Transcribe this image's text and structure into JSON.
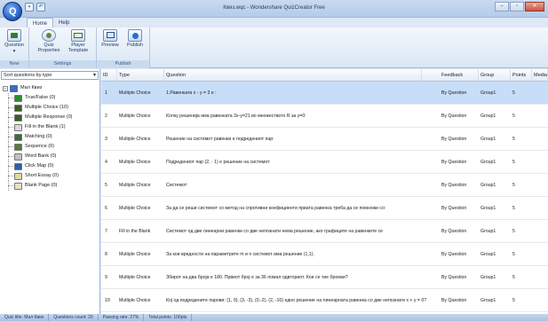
{
  "window": {
    "title": "Квиз.wqc - Wondershare QuizCreator Free",
    "controls": [
      "minimize",
      "maximize",
      "close"
    ]
  },
  "tabs": [
    {
      "label": "Home",
      "active": true
    },
    {
      "label": "Help",
      "active": false
    }
  ],
  "ribbon": {
    "groups": [
      {
        "label": "New",
        "buttons": [
          {
            "label": "Question",
            "icon": "question-icon"
          }
        ]
      },
      {
        "label": "Settings",
        "buttons": [
          {
            "label": "Quiz Properties",
            "icon": "gear-icon"
          },
          {
            "label": "Player Template",
            "icon": "template-icon"
          }
        ]
      },
      {
        "label": "Publish",
        "buttons": [
          {
            "label": "Preview",
            "icon": "preview-icon"
          },
          {
            "label": "Publish",
            "icon": "publish-icon"
          }
        ]
      }
    ]
  },
  "sidebar": {
    "sort_label": "Sort questions by type",
    "root": "Мал Квиз",
    "items": [
      {
        "label": "True/False  (0)",
        "color": "#2f8a2f"
      },
      {
        "label": "Multiple Choice  (10)",
        "color": "#3a5c2a"
      },
      {
        "label": "Multiple Response  (0)",
        "color": "#3a5c2a"
      },
      {
        "label": "Fill in the Blank  (1)",
        "color": "#d9d9d9"
      },
      {
        "label": "Matching  (0)",
        "color": "#3b6b3b"
      },
      {
        "label": "Sequence  (0)",
        "color": "#5a7a3a"
      },
      {
        "label": "Word Bank  (0)",
        "color": "#c0c0c0"
      },
      {
        "label": "Click Map  (0)",
        "color": "#2e5fa8"
      },
      {
        "label": "Short Essay  (0)",
        "color": "#e0d8a8"
      },
      {
        "label": "Blank Page  (0)",
        "color": "#e8e0c8"
      }
    ]
  },
  "grid": {
    "columns": [
      "ID",
      "Type",
      "Question",
      "Feedback",
      "Group",
      "Points",
      "Media"
    ],
    "rows": [
      {
        "id": "1",
        "type": "Multiple Choice",
        "question": "1.Равенката  x - y = 3  е :",
        "feedback": "By Question",
        "group": "Group1",
        "points": "5"
      },
      {
        "id": "2",
        "type": "Multiple Choice",
        "question": "Колку решенија има равенката 3x-y=21 во множеството R за y=0:",
        "feedback": "By Question",
        "group": "Group1",
        "points": "5"
      },
      {
        "id": "3",
        "type": "Multiple Choice",
        "question": "Решение на системот равенки  е подредениот пар:",
        "feedback": "By Question",
        "group": "Group1",
        "points": "5"
      },
      {
        "id": "4",
        "type": "Multiple Choice",
        "question": "Подредениот пар (2, - 1) е решение на системот",
        "feedback": "By Question",
        "group": "Group1",
        "points": "5"
      },
      {
        "id": "5",
        "type": "Multiple Choice",
        "question": "Системот:",
        "feedback": "By Question",
        "group": "Group1",
        "points": "5"
      },
      {
        "id": "6",
        "type": "Multiple Choice",
        "question": "За да се реши системот  со метод  на спротивни коефициенти  првата равенка треба да се помножи со:",
        "feedback": "By Question",
        "group": "Group1",
        "points": "5"
      },
      {
        "id": "7",
        "type": "Fill in the Blank",
        "question": "Системот од две линеарни равенки со две непознати нема решение, ако графиците на равенките се",
        "feedback": "By Question",
        "group": "Group1",
        "points": "5"
      },
      {
        "id": "8",
        "type": "Multiple Choice",
        "question": "За кои вредности на параметрите m и n системот   има решение (1,1).",
        "feedback": "By Question",
        "group": "Group1",
        "points": "5"
      },
      {
        "id": "9",
        "type": "Multiple Choice",
        "question": "Збирот на два броја е 180. Првиот број е за 36 помал одвториот. Кои се тие броеви?",
        "feedback": "By Question",
        "group": "Group1",
        "points": "5"
      },
      {
        "id": "10",
        "type": "Multiple Choice",
        "question": "Кој од подредените парови: (1, 0), (3, -3), (0,-2), (2, -10)  едно решение на линеарната равенка со две непознати x + y = 0?",
        "feedback": "By Question",
        "group": "Group1",
        "points": "5"
      }
    ],
    "selected_index": 0
  },
  "status": {
    "quiz_title": "Quiz title: Мал Квиз",
    "question_count": "Questions count: 20",
    "passing_rate": "Passing rate: 27%",
    "total_points": "Total points: 100pts"
  }
}
